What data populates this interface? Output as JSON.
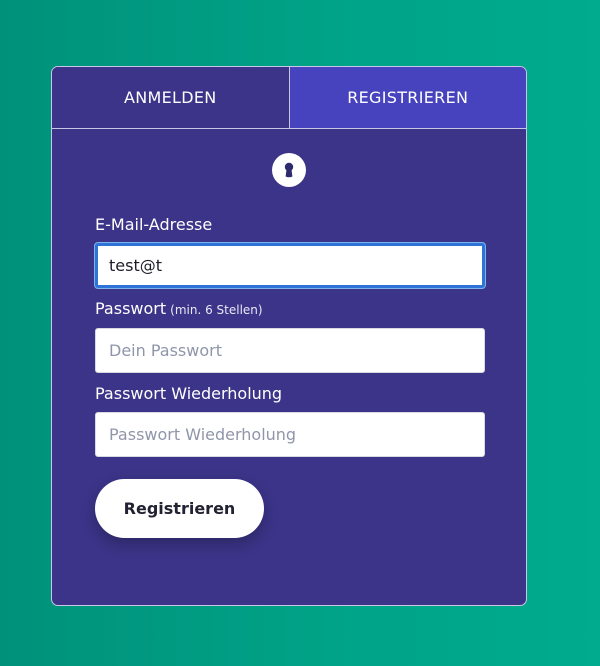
{
  "tabs": {
    "login_label": "ANMELDEN",
    "register_label": "REGISTRIEREN",
    "active": "register"
  },
  "header_icon": "keyhole-icon",
  "form": {
    "email": {
      "label": "E-Mail-Adresse",
      "value": "test@t"
    },
    "password": {
      "label": "Passwort",
      "hint": "(min. 6 Stellen)",
      "placeholder": "Dein Passwort",
      "value": ""
    },
    "password_repeat": {
      "label": "Passwort Wiederholung",
      "placeholder": "Passwort Wiederholung",
      "value": ""
    },
    "submit_label": "Registrieren"
  },
  "colors": {
    "background": "#00a387",
    "card": "#3b3488",
    "active_tab": "#4743be",
    "focus_ring": "#2d74d6"
  }
}
